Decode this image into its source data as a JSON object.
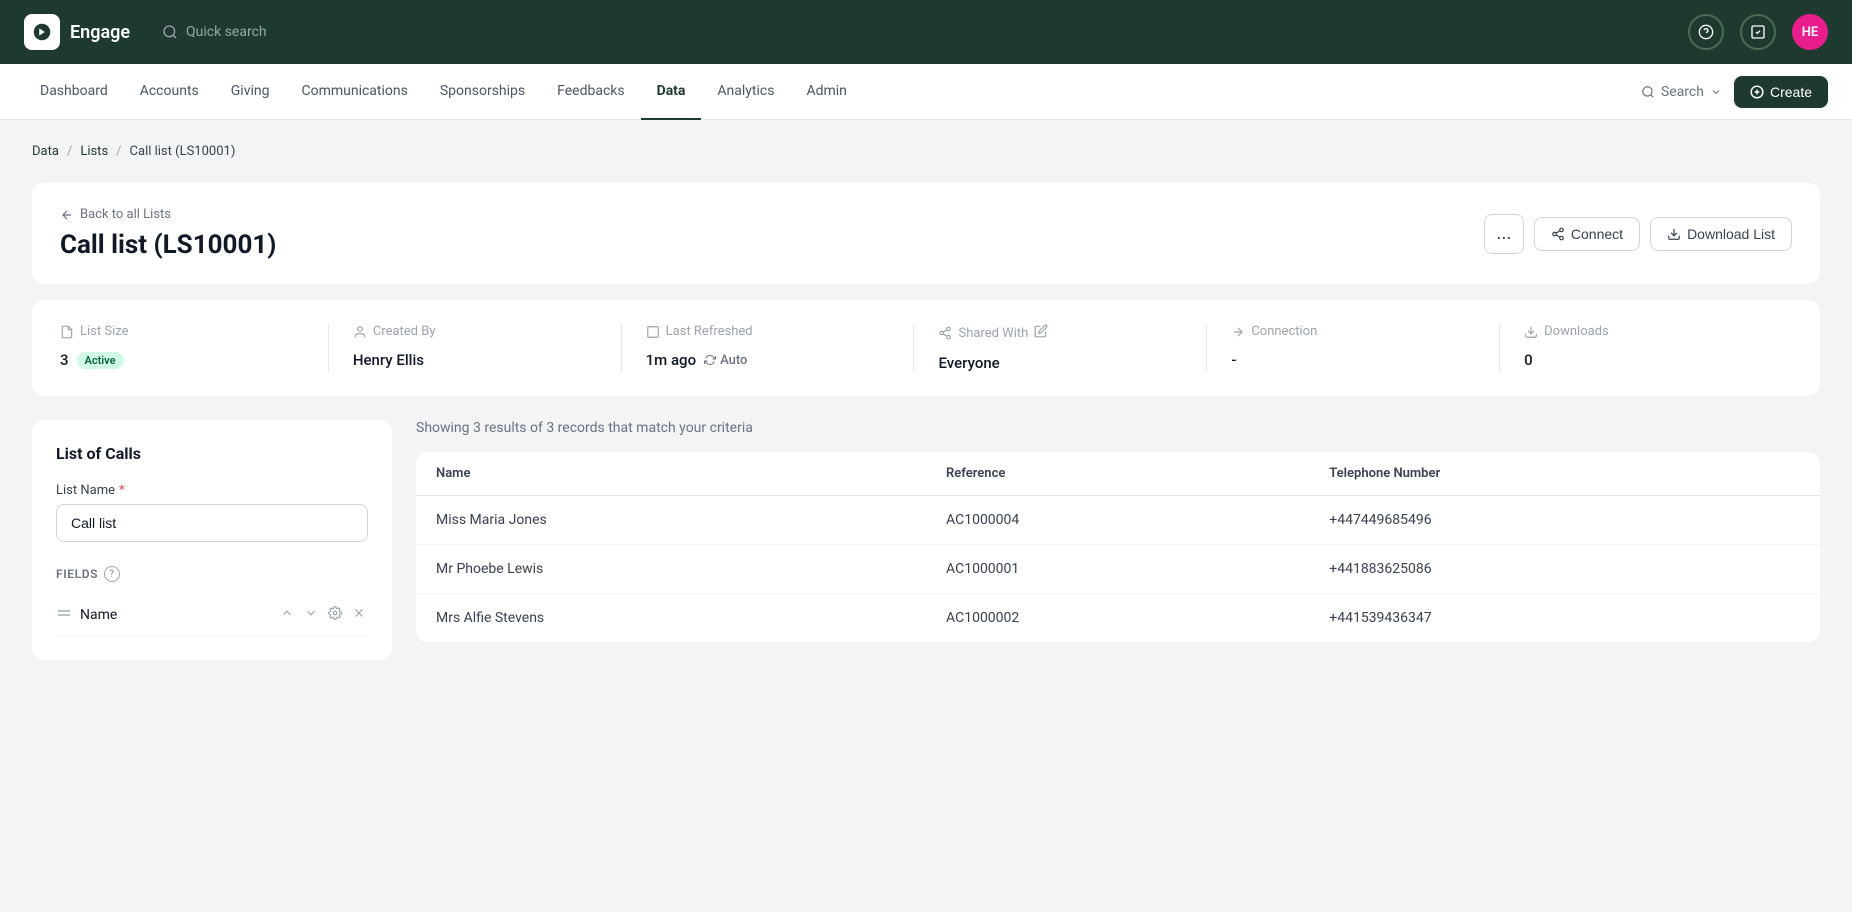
{
  "app": {
    "name": "Engage",
    "logo_alt": "Engage logo"
  },
  "topbar": {
    "search_placeholder": "Quick search",
    "avatar_initials": "HE"
  },
  "secondary_nav": {
    "items": [
      {
        "id": "dashboard",
        "label": "Dashboard"
      },
      {
        "id": "accounts",
        "label": "Accounts"
      },
      {
        "id": "giving",
        "label": "Giving"
      },
      {
        "id": "communications",
        "label": "Communications"
      },
      {
        "id": "sponsorships",
        "label": "Sponsorships"
      },
      {
        "id": "feedbacks",
        "label": "Feedbacks"
      },
      {
        "id": "data",
        "label": "Data",
        "active": true
      },
      {
        "id": "analytics",
        "label": "Analytics"
      },
      {
        "id": "admin",
        "label": "Admin"
      }
    ],
    "search_label": "Search",
    "create_label": "Create"
  },
  "breadcrumb": {
    "items": [
      {
        "label": "Data",
        "link": true
      },
      {
        "label": "Lists",
        "link": true
      },
      {
        "label": "Call list (LS10001)",
        "link": false
      }
    ]
  },
  "page_header": {
    "back_label": "Back to all Lists",
    "title": "Call list (LS10001)",
    "dots_label": "...",
    "connect_label": "Connect",
    "download_label": "Download List"
  },
  "stats": {
    "list_size_label": "List Size",
    "list_size_value": "3",
    "list_size_status": "Active",
    "created_by_label": "Created By",
    "created_by_value": "Henry Ellis",
    "last_refreshed_label": "Last Refreshed",
    "last_refreshed_value": "1m ago",
    "last_refreshed_auto": "Auto",
    "shared_with_label": "Shared With",
    "shared_with_value": "Everyone",
    "connection_label": "Connection",
    "connection_value": "-",
    "downloads_label": "Downloads",
    "downloads_value": "0"
  },
  "left_panel": {
    "title": "List of Calls",
    "list_name_label": "List Name",
    "list_name_required": true,
    "list_name_value": "Call list",
    "fields_label": "FIELDS",
    "fields_help": "?",
    "fields": [
      {
        "name": "Name"
      }
    ]
  },
  "results": {
    "summary": "Showing 3 results of 3 records that match your criteria",
    "columns": [
      "Name",
      "Reference",
      "Telephone Number"
    ],
    "rows": [
      {
        "name": "Miss Maria Jones",
        "reference": "AC1000004",
        "telephone": "+447449685496"
      },
      {
        "name": "Mr Phoebe Lewis",
        "reference": "AC1000001",
        "telephone": "+441883625086"
      },
      {
        "name": "Mrs Alfie Stevens",
        "reference": "AC1000002",
        "telephone": "+441539436347"
      }
    ]
  }
}
